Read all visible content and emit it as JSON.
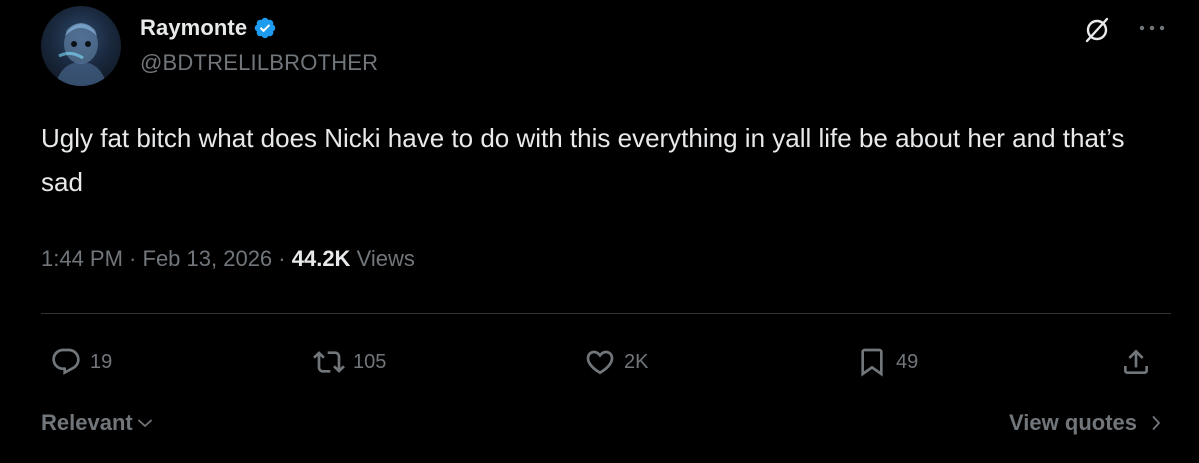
{
  "author": {
    "display_name": "Raymonte",
    "handle": "@BDTRELILBROTHER",
    "verified": true
  },
  "tweet": {
    "text": "Ugly fat bitch what does Nicki have to do with this everything in yall life be about her and that’s sad",
    "time": "1:44 PM",
    "separator": " · ",
    "date": "Feb 13, 2026",
    "views_count": "44.2K",
    "views_label": "Views"
  },
  "actions": {
    "reply_count": "19",
    "repost_count": "105",
    "like_count": "2K",
    "bookmark_count": "49"
  },
  "footer": {
    "sort_label": "Relevant",
    "quotes_label": "View quotes"
  },
  "icons": {
    "verified": "verified-badge-icon",
    "grok": "grok-icon",
    "more": "more-icon",
    "reply": "reply-icon",
    "repost": "repost-icon",
    "like": "heart-icon",
    "bookmark": "bookmark-icon",
    "share": "share-icon"
  },
  "colors": {
    "background": "#000000",
    "text_primary": "#e7e9ea",
    "text_secondary": "#71767b",
    "verified_blue": "#1d9bf0",
    "divider": "#2f3336"
  }
}
